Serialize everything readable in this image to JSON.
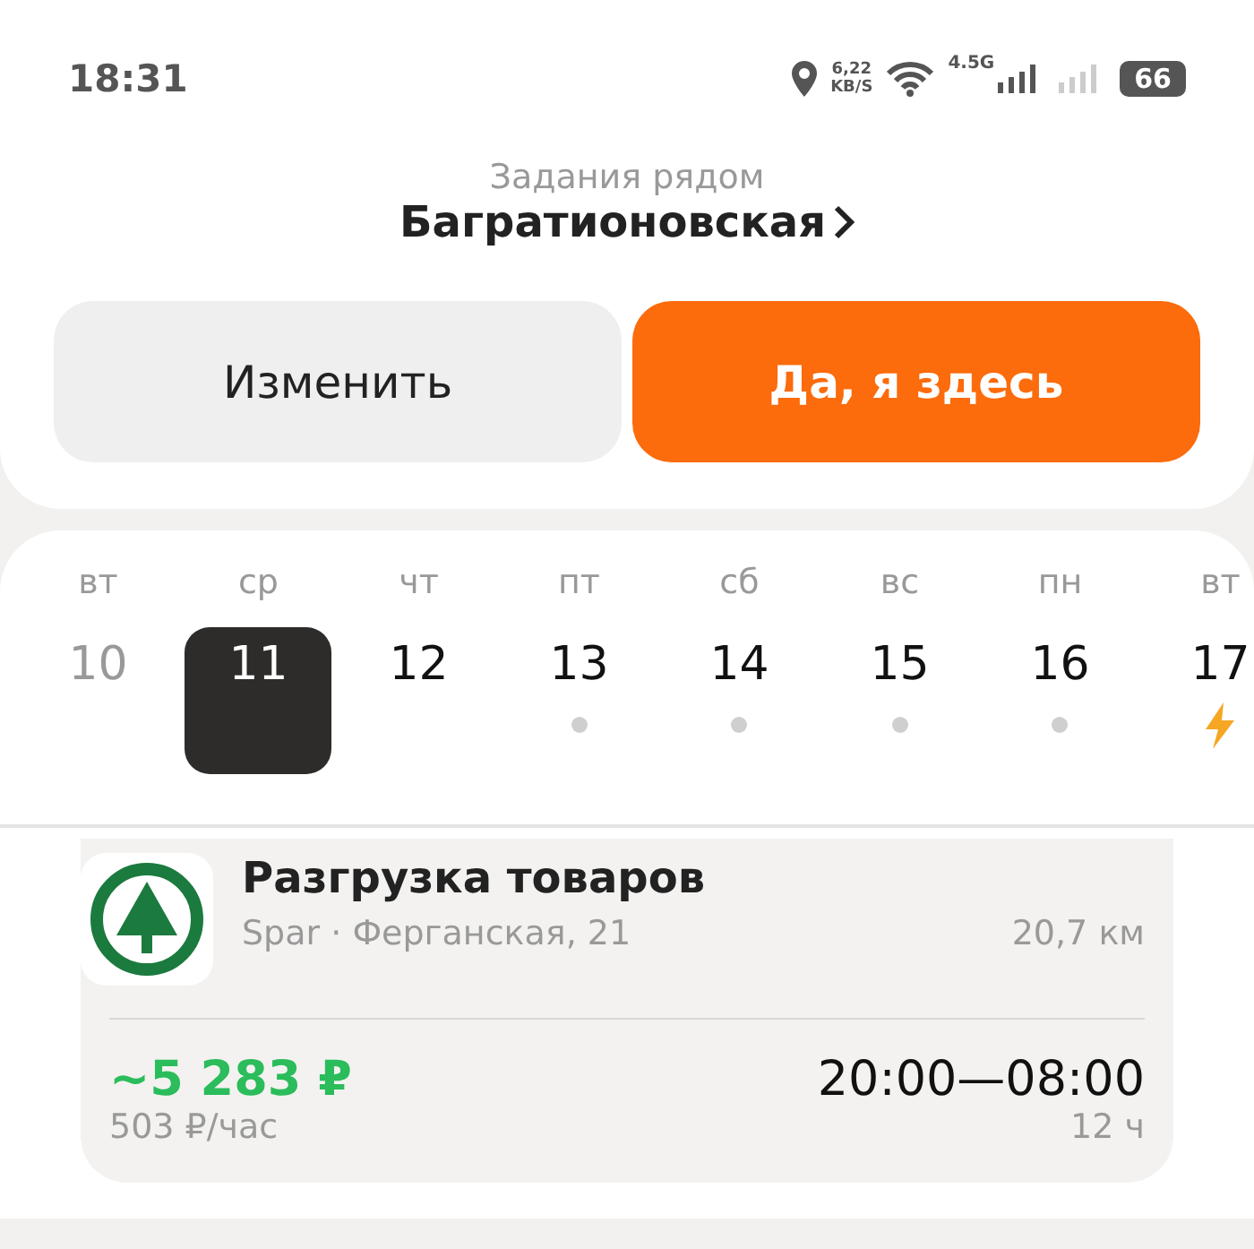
{
  "status_bar": {
    "time": "18:31",
    "speed_value": "6,22",
    "speed_unit": "KB/S",
    "network": "4.5G",
    "battery": "66"
  },
  "header": {
    "subtitle": "Задания рядом",
    "location": "Багратионовская"
  },
  "buttons": [
    {
      "label": "Изменить",
      "kind": "secondary"
    },
    {
      "label": "Да, я здесь",
      "kind": "primary"
    }
  ],
  "calendar": [
    {
      "weekday": "вт",
      "day": "10",
      "selected": false,
      "past": true,
      "has_tasks": false,
      "urgent": false
    },
    {
      "weekday": "ср",
      "day": "11",
      "selected": true,
      "past": false,
      "has_tasks": false,
      "urgent": false
    },
    {
      "weekday": "чт",
      "day": "12",
      "selected": false,
      "past": false,
      "has_tasks": false,
      "urgent": false
    },
    {
      "weekday": "пт",
      "day": "13",
      "selected": false,
      "past": false,
      "has_tasks": true,
      "urgent": false
    },
    {
      "weekday": "сб",
      "day": "14",
      "selected": false,
      "past": false,
      "has_tasks": true,
      "urgent": false
    },
    {
      "weekday": "вс",
      "day": "15",
      "selected": false,
      "past": false,
      "has_tasks": true,
      "urgent": false
    },
    {
      "weekday": "пн",
      "day": "16",
      "selected": false,
      "past": false,
      "has_tasks": true,
      "urgent": false
    },
    {
      "weekday": "вт",
      "day": "17",
      "selected": false,
      "past": false,
      "has_tasks": false,
      "urgent": true
    }
  ],
  "task": {
    "title": "Разгрузка товаров",
    "place": "Spar · Ферганская, 21",
    "distance": "20,7 км",
    "pay": "~5 283 ₽",
    "rate": "503 ₽/час",
    "time": "20:00—08:00",
    "duration": "12 ч"
  }
}
